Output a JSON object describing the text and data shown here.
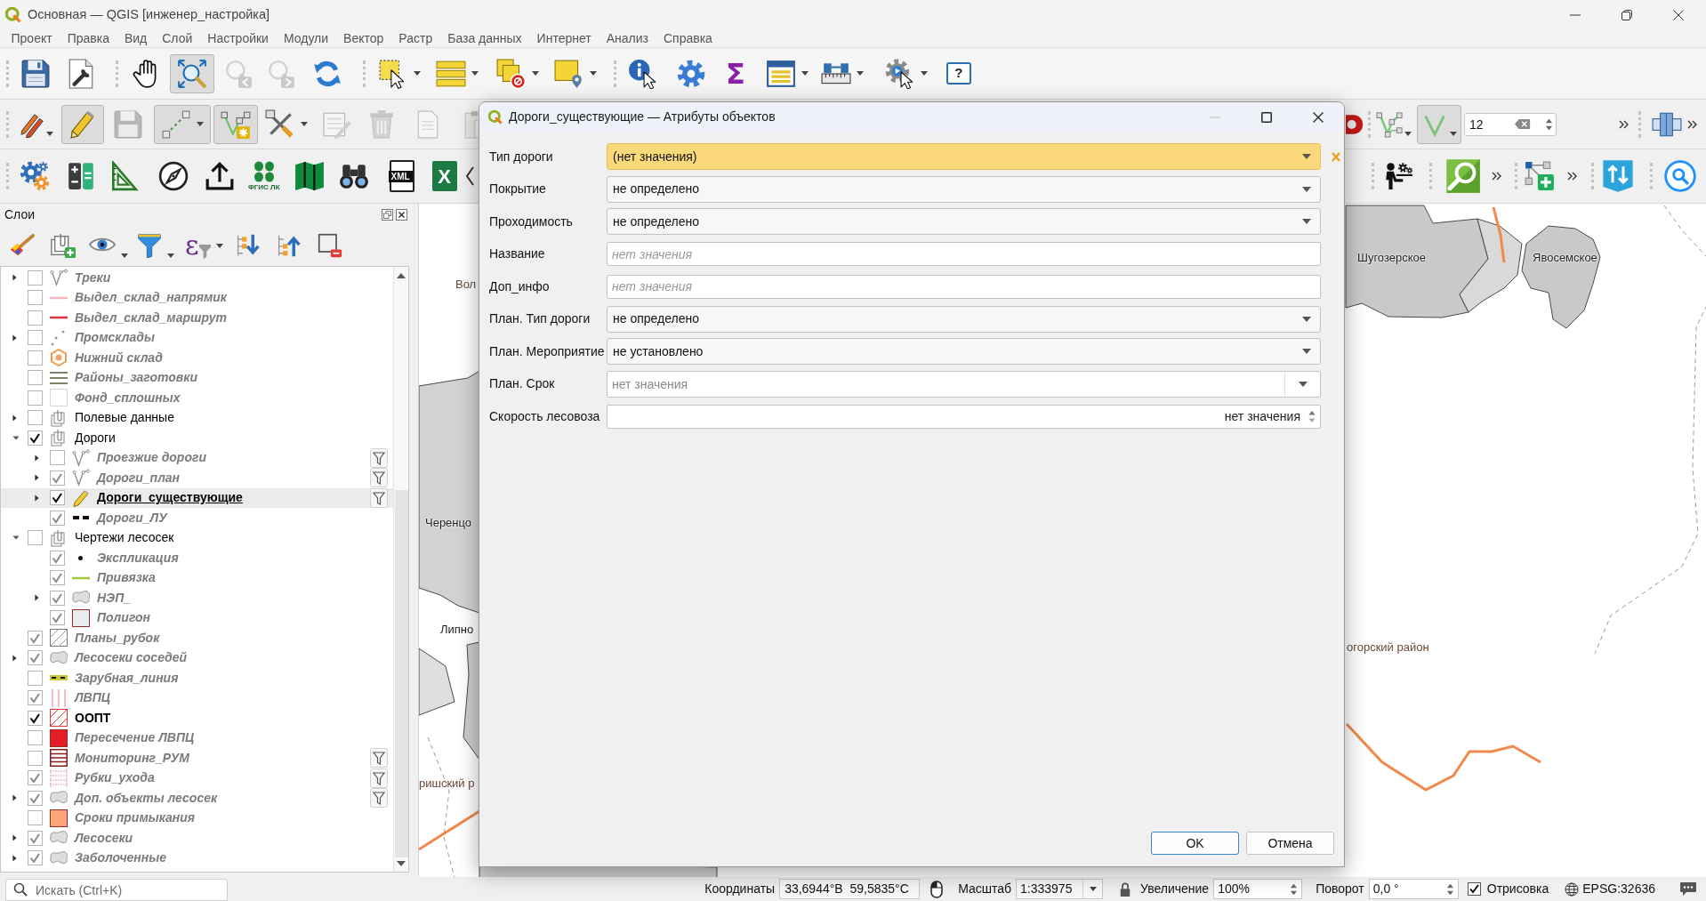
{
  "window": {
    "title": "Основная — QGIS [инженер_настройка]"
  },
  "menu": [
    "Проект",
    "Правка",
    "Вид",
    "Слой",
    "Настройки",
    "Модули",
    "Вектор",
    "Растр",
    "База данных",
    "Интернет",
    "Анализ",
    "Справка"
  ],
  "toolbars": {
    "row_1": [
      {
        "pressed": false,
        "disabled": false
      },
      {
        "pressed": false,
        "disabled": false
      },
      {
        "pressed": false,
        "disabled": false
      },
      {
        "pressed": true,
        "disabled": false
      },
      {
        "pressed": false,
        "disabled": true
      },
      {
        "pressed": false,
        "disabled": true
      },
      {
        "pressed": false,
        "disabled": false
      },
      {
        "pressed": false,
        "disabled": false
      },
      {
        "pressed": false,
        "disabled": false
      },
      {
        "pressed": false,
        "disabled": false
      },
      {
        "pressed": false,
        "disabled": false
      },
      {
        "pressed": false,
        "disabled": false
      },
      {
        "pressed": false,
        "disabled": false
      },
      {
        "pressed": false,
        "disabled": false,
        "glyph": "Σ"
      },
      {
        "pressed": false,
        "disabled": false
      },
      {
        "pressed": false,
        "disabled": false
      },
      {
        "pressed": false,
        "disabled": false
      },
      {
        "pressed": false,
        "disabled": false,
        "glyph": "?"
      }
    ],
    "row_2_left": [
      {
        "pressed": false,
        "disabled": false
      },
      {
        "pressed": true,
        "disabled": false
      },
      {
        "pressed": false,
        "disabled": true
      },
      {
        "pressed": true,
        "disabled": false
      },
      {
        "pressed": true,
        "disabled": false
      },
      {
        "pressed": false,
        "disabled": false
      },
      {
        "pressed": false,
        "disabled": true
      },
      {
        "pressed": false,
        "disabled": true
      },
      {
        "pressed": false,
        "disabled": true
      },
      {
        "pressed": false,
        "disabled": true
      }
    ],
    "row_2_right": [
      {
        "pressed": false,
        "disabled": false
      },
      {
        "pressed": false,
        "disabled": false
      },
      {
        "pressed": true,
        "disabled": false
      },
      {
        "value": "12",
        "disabled": false
      },
      {
        "pressed": false,
        "disabled": false
      },
      {
        "pressed": false,
        "disabled": false
      },
      {
        "pressed": false,
        "disabled": false
      }
    ],
    "row_3_left": [
      {
        "pressed": false,
        "disabled": false
      },
      {
        "pressed": false,
        "disabled": false
      },
      {
        "pressed": false,
        "disabled": false
      },
      {
        "pressed": false,
        "disabled": false
      },
      {
        "pressed": false,
        "disabled": false
      },
      {
        "pressed": false,
        "disabled": false,
        "glyph": "ФГИС ЛК"
      },
      {
        "pressed": false,
        "disabled": false
      },
      {
        "pressed": false,
        "disabled": false
      },
      {
        "pressed": false,
        "disabled": false,
        "glyph": "XML"
      },
      {
        "pressed": false,
        "disabled": false,
        "glyph": "X"
      },
      {
        "pressed": false,
        "disabled": false
      }
    ],
    "row_3_right": [
      {
        "pressed": false,
        "disabled": false
      },
      {
        "pressed": false,
        "disabled": false
      },
      {
        "pressed": false,
        "disabled": false
      },
      {
        "pressed": false,
        "disabled": false
      },
      {
        "pressed": false,
        "disabled": false
      },
      {
        "pressed": false,
        "disabled": false
      },
      {
        "pressed": false,
        "disabled": false
      }
    ]
  },
  "layers_panel": {
    "title": "Слои",
    "expression_glyph": "ε",
    "tree": [
      {
        "name": "Треки",
        "kind": "vertices",
        "checked": false,
        "in_scale": false,
        "bold": true,
        "selected": false,
        "filtered": false,
        "expanded": false
      },
      {
        "name": "Выдел_склад_напрямик",
        "kind": "line",
        "color": "#f4b8bc",
        "checked": false,
        "in_scale": false,
        "bold": true,
        "selected": false,
        "filtered": false
      },
      {
        "name": "Выдел_склад_маршрут",
        "kind": "line",
        "color": "#e2343f",
        "checked": false,
        "in_scale": false,
        "bold": true,
        "selected": false,
        "filtered": false
      },
      {
        "name": "Промсклады",
        "kind": "points",
        "checked": false,
        "in_scale": false,
        "bold": true,
        "selected": false,
        "filtered": false,
        "expanded": false
      },
      {
        "name": "Нижний склад",
        "kind": "hexagon",
        "checked": false,
        "in_scale": false,
        "bold": true,
        "selected": false,
        "filtered": false
      },
      {
        "name": "Районы_заготовки",
        "kind": "stripes",
        "checked": false,
        "in_scale": false,
        "bold": true,
        "selected": false,
        "filtered": false
      },
      {
        "name": "Фонд_сплошных",
        "kind": "empty",
        "checked": false,
        "in_scale": false,
        "bold": true,
        "selected": false,
        "filtered": false
      },
      {
        "name": "Полевые данные",
        "kind": "group",
        "checked": false,
        "in_scale": true,
        "bold": false,
        "selected": false,
        "filtered": false,
        "expanded": false
      },
      {
        "name": "Дороги",
        "kind": "group",
        "checked": true,
        "in_scale": true,
        "bold": false,
        "selected": false,
        "filtered": false,
        "expanded": true,
        "children": [
          {
            "name": "Проезжие дороги",
            "kind": "vertices",
            "checked": false,
            "in_scale": false,
            "bold": true,
            "selected": false,
            "filtered": true,
            "expanded": false
          },
          {
            "name": "Дороги_план",
            "kind": "vertices",
            "checked": true,
            "in_scale": false,
            "bold": true,
            "selected": false,
            "filtered": true,
            "expanded": false
          },
          {
            "name": "Дороги_существующие",
            "kind": "pencil",
            "checked": true,
            "in_scale": true,
            "bold": true,
            "selected": true,
            "filtered": true,
            "expanded": false
          },
          {
            "name": "Дороги_ЛУ",
            "kind": "dashes",
            "checked": true,
            "in_scale": false,
            "bold": true,
            "selected": false,
            "filtered": false
          }
        ]
      },
      {
        "name": "Чертежи лесосек",
        "kind": "group",
        "checked": false,
        "in_scale": true,
        "bold": false,
        "selected": false,
        "filtered": false,
        "expanded": true,
        "children": [
          {
            "name": "Экспликация",
            "kind": "dot",
            "checked": true,
            "in_scale": false,
            "bold": true,
            "selected": false,
            "filtered": false
          },
          {
            "name": "Привязка",
            "kind": "line",
            "color": "#9fc93c",
            "checked": true,
            "in_scale": false,
            "bold": true,
            "selected": false,
            "filtered": false
          },
          {
            "name": "НЭП_",
            "kind": "blob",
            "checked": true,
            "in_scale": false,
            "bold": true,
            "selected": false,
            "filtered": false,
            "expanded": false
          },
          {
            "name": "Полигон",
            "kind": "fill",
            "color": "#ececec",
            "checked": true,
            "in_scale": false,
            "bold": true,
            "selected": false,
            "filtered": false
          }
        ]
      },
      {
        "name": "Планы_рубок",
        "kind": "hatch",
        "checked": true,
        "in_scale": false,
        "bold": true,
        "selected": false,
        "filtered": false
      },
      {
        "name": "Лесосеки соседей",
        "kind": "blob",
        "checked": true,
        "in_scale": false,
        "bold": true,
        "selected": false,
        "filtered": false,
        "expanded": false
      },
      {
        "name": "Зарубная_линия",
        "kind": "dashline",
        "checked": false,
        "in_scale": false,
        "bold": true,
        "selected": false,
        "filtered": false
      },
      {
        "name": "ЛВПЦ",
        "kind": "vlines",
        "checked": true,
        "in_scale": false,
        "bold": true,
        "selected": false,
        "filtered": false
      },
      {
        "name": "ООПТ",
        "kind": "redhatch",
        "checked": true,
        "in_scale": true,
        "bold": true,
        "selected": false,
        "filtered": false
      },
      {
        "name": "Пересечение ЛВПЦ",
        "kind": "fill",
        "color": "#e31e24",
        "checked": false,
        "in_scale": false,
        "bold": true,
        "selected": false,
        "filtered": false
      },
      {
        "name": "Мониторинг_РУМ",
        "kind": "hlines",
        "checked": false,
        "in_scale": false,
        "bold": true,
        "selected": false,
        "filtered": true
      },
      {
        "name": "Рубки_ухода",
        "kind": "hlineslight",
        "checked": true,
        "in_scale": false,
        "bold": true,
        "selected": false,
        "filtered": true
      },
      {
        "name": "Доп. объекты лесосек",
        "kind": "blob",
        "checked": true,
        "in_scale": false,
        "bold": true,
        "selected": false,
        "filtered": true,
        "expanded": false
      },
      {
        "name": "Сроки примыкания",
        "kind": "fill",
        "color": "#fca577",
        "checked": false,
        "in_scale": false,
        "bold": true,
        "selected": false,
        "filtered": false
      },
      {
        "name": "Лесосеки",
        "kind": "blob",
        "checked": true,
        "in_scale": false,
        "bold": true,
        "selected": false,
        "filtered": false,
        "expanded": false
      },
      {
        "name": "Заболоченные",
        "kind": "blob",
        "checked": true,
        "in_scale": false,
        "bold": true,
        "selected": false,
        "filtered": false,
        "expanded": false
      }
    ]
  },
  "map": {
    "labels": [
      {
        "text": "Шугозерское",
        "kind": "settlement"
      },
      {
        "text": "Явосемское",
        "kind": "settlement"
      },
      {
        "text": "Вол",
        "kind": "district"
      },
      {
        "text": "Черенцо",
        "kind": "settlement"
      },
      {
        "text": "Липно",
        "kind": "settlement"
      },
      {
        "text": "огорский район",
        "kind": "district"
      },
      {
        "text": "ришский р",
        "kind": "district"
      }
    ]
  },
  "dialog": {
    "title": "Дороги_существующие — Атрибуты объектов",
    "fields": [
      {
        "label": "Тип дороги",
        "kind": "combo",
        "value": "(нет значения)",
        "invalid": true
      },
      {
        "label": "Покрытие",
        "kind": "combo",
        "value": "не определено",
        "invalid": false
      },
      {
        "label": "Проходимость",
        "kind": "combo",
        "value": "не определено",
        "invalid": false
      },
      {
        "label": "Название",
        "kind": "text",
        "placeholder": "нет значения",
        "invalid": false
      },
      {
        "label": "Доп_инфо",
        "kind": "text",
        "placeholder": "нет значения",
        "invalid": false
      },
      {
        "label": "План. Тип дороги",
        "kind": "combo",
        "value": "не определено",
        "invalid": false
      },
      {
        "label": "План. Мероприятие",
        "kind": "combo",
        "value": "не установлено",
        "invalid": false
      },
      {
        "label": "План. Срок",
        "kind": "date",
        "placeholder": "нет значения",
        "invalid": false
      },
      {
        "label": "Скорость лесовоза",
        "kind": "spin",
        "value": "нет значения",
        "invalid": false
      }
    ],
    "buttons": [
      {
        "label": "OK",
        "default": true
      },
      {
        "label": "Отмена",
        "default": false
      }
    ]
  },
  "status_bar": {
    "locator_placeholder": "Искать (Ctrl+K)",
    "coordinate_label": "Координаты",
    "coordinate": "33,6944°В  59,5835°С",
    "scale_label": "Масштаб",
    "scale": "1:333975",
    "magnifier_label": "Увеличение",
    "magnifier": "100%",
    "rotation_label": "Поворот",
    "rotation": "0,0 °",
    "render_label": "Отрисовка",
    "render": true,
    "crs": "EPSG:32636"
  }
}
